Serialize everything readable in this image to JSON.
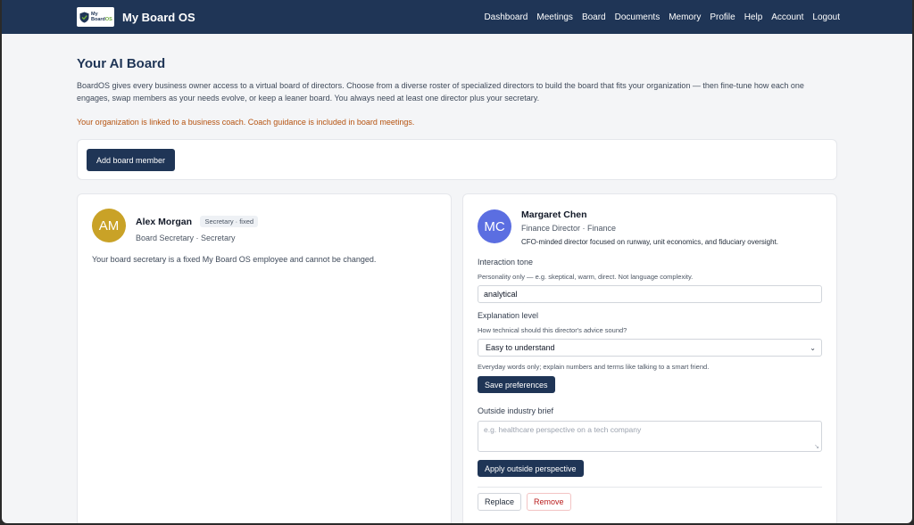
{
  "header": {
    "logo_text_top": "My",
    "logo_text_bottom": "Board",
    "logo_text_suffix": "OS",
    "brand": "My Board OS",
    "nav": [
      "Dashboard",
      "Meetings",
      "Board",
      "Documents",
      "Memory",
      "Profile",
      "Help",
      "Account",
      "Logout"
    ]
  },
  "page": {
    "title": "Your AI Board",
    "intro": "BoardOS gives every business owner access to a virtual board of directors. Choose from a diverse roster of specialized directors to build the board that fits your organization — then fine-tune how each one engages, swap members as your needs evolve, or keep a leaner board. You always need at least one director plus your secretary.",
    "coach_notice": "Your organization is linked to a business coach. Coach guidance is included in board meetings.",
    "add_button": "Add board member"
  },
  "secretary": {
    "initials": "AM",
    "avatar_color": "#c9a227",
    "name": "Alex Morgan",
    "badge": "Secretary · fixed",
    "role": "Board Secretary · Secretary",
    "note": "Your board secretary is a fixed My Board OS employee and cannot be changed."
  },
  "director": {
    "initials": "MC",
    "avatar_color": "#5b6ee1",
    "name": "Margaret Chen",
    "role": "Finance Director · Finance",
    "description": "CFO-minded director focused on runway, unit economics, and fiduciary oversight.",
    "tone_label": "Interaction tone",
    "tone_hint": "Personality only — e.g. skeptical, warm, direct. Not language complexity.",
    "tone_value": "analytical",
    "level_label": "Explanation level",
    "level_hint": "How technical should this director's advice sound?",
    "level_value": "Easy to understand",
    "level_note": "Everyday words only; explain numbers and terms like talking to a smart friend.",
    "save_button": "Save preferences",
    "brief_label": "Outside industry brief",
    "brief_placeholder": "e.g. healthcare perspective on a tech company",
    "apply_button": "Apply outside perspective",
    "replace_button": "Replace",
    "remove_button": "Remove"
  }
}
